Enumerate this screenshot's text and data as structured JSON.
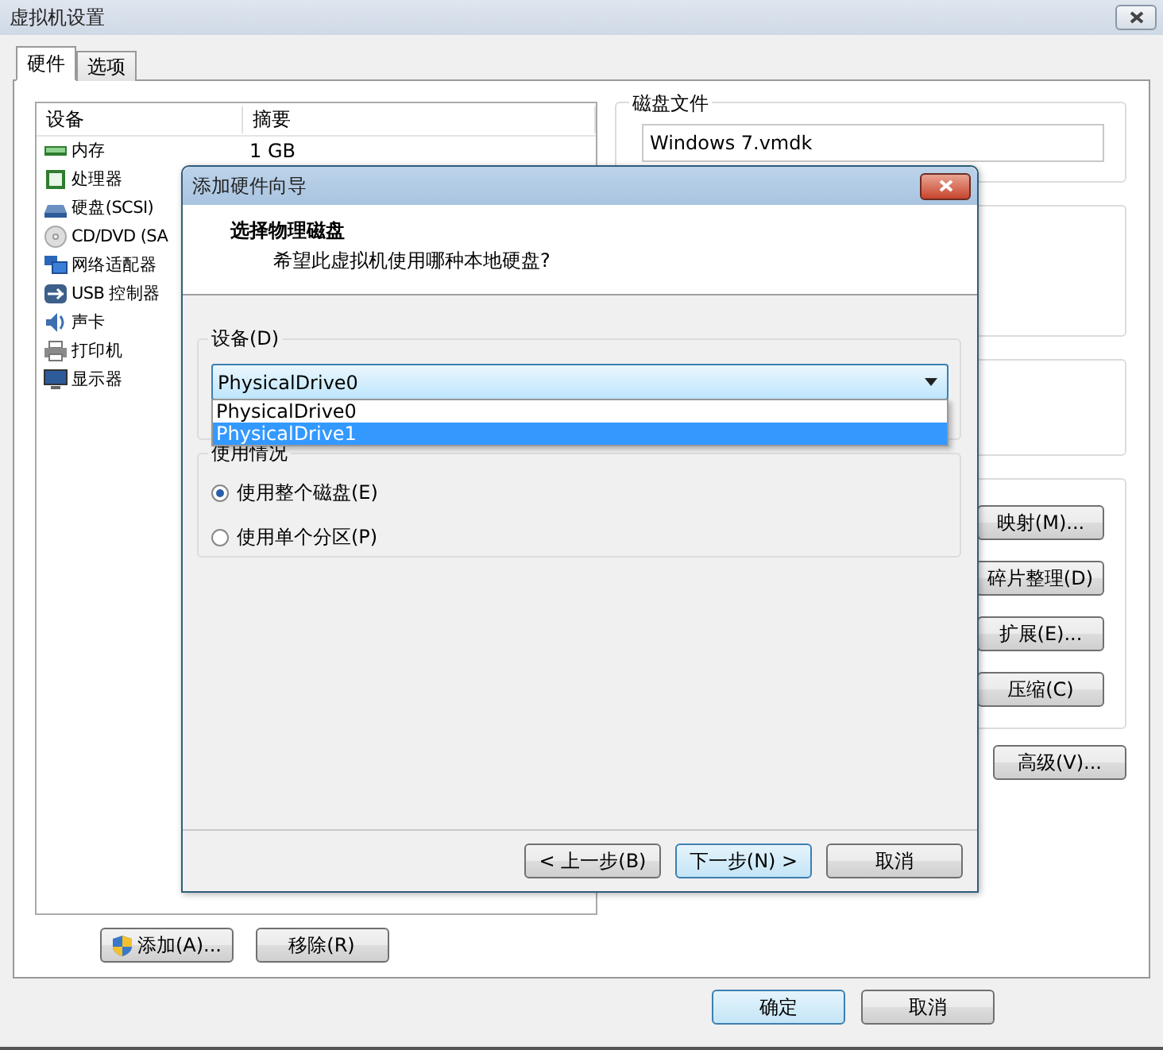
{
  "window": {
    "title": "虚拟机设置"
  },
  "tabs": [
    {
      "label": "硬件",
      "selected": true
    },
    {
      "label": "选项",
      "selected": false
    }
  ],
  "device_list": {
    "columns": [
      "设备",
      "摘要"
    ],
    "rows": [
      {
        "kind": "memory",
        "name": "内存",
        "summary": "1 GB"
      },
      {
        "kind": "cpu",
        "name": "处理器"
      },
      {
        "kind": "disk",
        "name": "硬盘(SCSI)"
      },
      {
        "kind": "cd",
        "name": "CD/DVD (SA"
      },
      {
        "kind": "network",
        "name": "网络适配器"
      },
      {
        "kind": "usb",
        "name": "USB 控制器"
      },
      {
        "kind": "sound",
        "name": "声卡"
      },
      {
        "kind": "printer",
        "name": "打印机"
      },
      {
        "kind": "display",
        "name": "显示器"
      }
    ]
  },
  "list_buttons": [
    {
      "kind": "shield",
      "label": "添加(A)..."
    },
    {
      "kind": "plain",
      "label": "移除(R)"
    }
  ],
  "disk_file": {
    "label": "磁盘文件",
    "value": "Windows 7.vmdk"
  },
  "disk_buttons": [
    "映射(M)...",
    "碎片整理(D)",
    "扩展(E)...",
    "压缩(C)"
  ],
  "advanced_button": "高级(V)...",
  "footer_buttons": [
    {
      "label": "确定",
      "default": true
    },
    {
      "label": "取消",
      "default": false
    }
  ],
  "dialog": {
    "title": "添加硬件向导",
    "heading": "选择物理磁盘",
    "subtitle": "希望此虚拟机使用哪种本地硬盘?",
    "device_group": "设备(D)",
    "combo_value": "PhysicalDrive0",
    "expanded": true,
    "options": [
      {
        "label": "PhysicalDrive0",
        "selected": false
      },
      {
        "label": "PhysicalDrive1",
        "selected": true
      }
    ],
    "usage_group": "使用情况",
    "radios": [
      {
        "label": "使用整个磁盘(E)",
        "selected": true
      },
      {
        "label": "使用单个分区(P)",
        "selected": false
      }
    ],
    "buttons": [
      {
        "label": "< 上一步(B)",
        "default": false
      },
      {
        "label": "下一步(N) >",
        "default": true
      },
      {
        "label": "取消",
        "default": false
      }
    ]
  }
}
